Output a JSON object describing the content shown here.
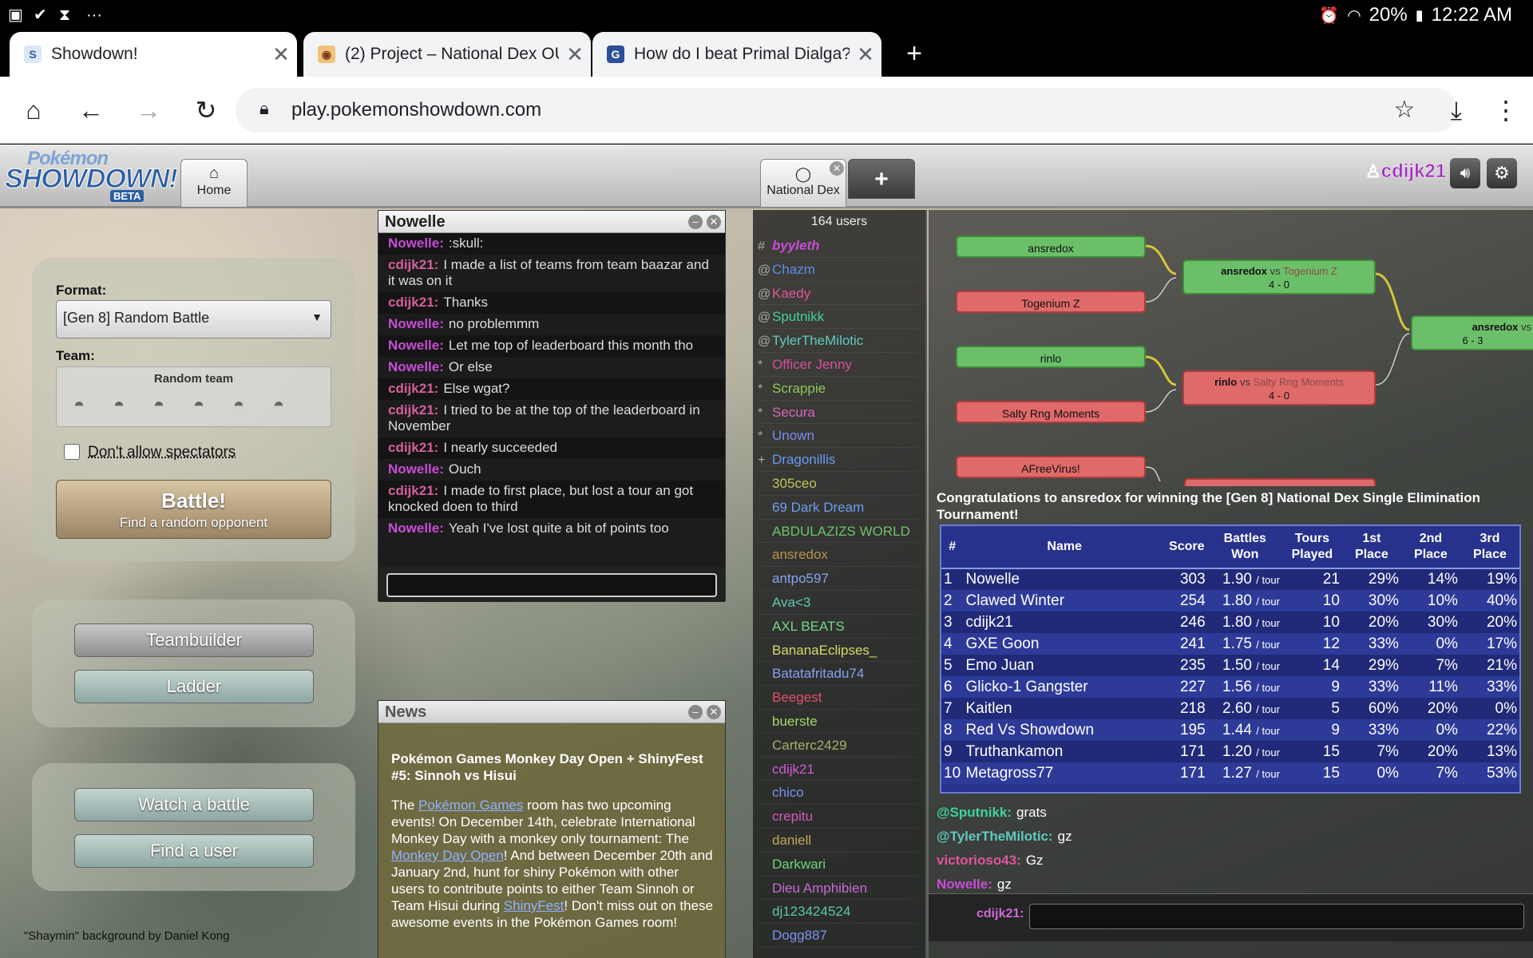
{
  "status": {
    "time": "12:22 AM",
    "battery": "20%",
    "icons": [
      "image-icon",
      "check-icon",
      "hourglass-icon",
      "more-icon"
    ]
  },
  "tabs": [
    {
      "title": "Showdown!",
      "favicon": "showdown-icon",
      "active": true
    },
    {
      "title": "(2) Project – National Dex OU",
      "favicon": "smogon-icon",
      "active": false
    },
    {
      "title": "How do I beat Primal Dialga?",
      "favicon": "gamefaqs-icon",
      "active": false
    }
  ],
  "browser": {
    "url": "play.pokemonshowdown.com"
  },
  "header": {
    "logo_line1": "Pokémon",
    "logo_line2": "SHOWDOWN!",
    "logo_badge": "BETA",
    "home_tab": "Home",
    "room_tab": "National Dex",
    "username": "cdijk21"
  },
  "menu": {
    "format_label": "Format:",
    "format_value": "[Gen 8] Random Battle",
    "team_label": "Team:",
    "team_value": "Random team",
    "spectators_label": "Don't allow spectators",
    "battle_label": "Battle!",
    "battle_sub": "Find a random opponent",
    "teambuilder": "Teambuilder",
    "ladder": "Ladder",
    "watch": "Watch a battle",
    "find_user": "Find a user",
    "credit": "\"Shaymin\" background by Daniel Kong"
  },
  "pm": {
    "title": "Nowelle",
    "messages": [
      {
        "user": "Nowelle:",
        "text": ":skull:",
        "color": "#c74dd6"
      },
      {
        "user": "cdijk21:",
        "text": "I made a list of teams from team baazar and it was on it",
        "color": "#d65f9a"
      },
      {
        "user": "cdijk21:",
        "text": "Thanks",
        "color": "#d65f9a"
      },
      {
        "user": "Nowelle:",
        "text": "no problemmm",
        "color": "#c74dd6"
      },
      {
        "user": "Nowelle:",
        "text": "Let me top of leaderboard this month tho",
        "color": "#c74dd6"
      },
      {
        "user": "Nowelle:",
        "text": "Or else",
        "color": "#c74dd6"
      },
      {
        "user": "cdijk21:",
        "text": "Else wgat?",
        "color": "#d65f9a"
      },
      {
        "user": "cdijk21:",
        "text": "I tried to be at the top of the leaderboard in November",
        "color": "#d65f9a"
      },
      {
        "user": "cdijk21:",
        "text": "I nearly succeeded",
        "color": "#d65f9a"
      },
      {
        "user": "Nowelle:",
        "text": "Ouch",
        "color": "#c74dd6"
      },
      {
        "user": "cdijk21:",
        "text": "I made to first place, but lost a tour an got knocked doen to third",
        "color": "#d65f9a"
      },
      {
        "user": "Nowelle:",
        "text": "Yeah I've lost quite a bit of points too",
        "color": "#c74dd6"
      }
    ]
  },
  "news": {
    "title": "News",
    "headline": "Pokémon Games Monkey Day Open + ShinyFest #5: Sinnoh vs Hisui",
    "t1": "The ",
    "link1": "Pokémon Games",
    "t2": " room has two upcoming events! On December 14th, celebrate International Monkey Day with a monkey only tournament: The ",
    "link2": "Monkey Day Open",
    "t3": "! And between December 20th and January 2nd, hunt for shiny Pokémon with other users to contribute points to either Team Sinnoh or Team Hisui during ",
    "link3": "ShinyFest",
    "t4": "! Don't miss out on these awesome events in the Pokémon Games room!"
  },
  "userlist": {
    "count": "164 users",
    "users": [
      {
        "rank": "#",
        "name": "byyleth",
        "color": "#c74dd6",
        "italic": true
      },
      {
        "rank": "@",
        "name": "Chazm",
        "color": "#5b8de8"
      },
      {
        "rank": "@",
        "name": "Kaedy",
        "color": "#e0559b"
      },
      {
        "rank": "@",
        "name": "Sputnikk",
        "color": "#3fd39a"
      },
      {
        "rank": "@",
        "name": "TylerTheMilotic",
        "color": "#5fc9c0"
      },
      {
        "rank": "*",
        "name": "Officer Jenny",
        "color": "#d44f9e"
      },
      {
        "rank": "*",
        "name": "Scrappie",
        "color": "#8ec95a"
      },
      {
        "rank": "*",
        "name": "Secura",
        "color": "#d667bd"
      },
      {
        "rank": "*",
        "name": "Unown",
        "color": "#7a8af0"
      },
      {
        "rank": "+",
        "name": "Dragonillis",
        "color": "#6a9af0"
      },
      {
        "rank": "",
        "name": "305ceo",
        "color": "#c2c25a"
      },
      {
        "rank": "",
        "name": "69 Dark Dream",
        "color": "#6d9ef0"
      },
      {
        "rank": "",
        "name": "ABDULAZIZS WORLD",
        "color": "#6ec26a"
      },
      {
        "rank": "",
        "name": "ansredox",
        "color": "#b8924e"
      },
      {
        "rank": "",
        "name": "antpo597",
        "color": "#8aa2f0"
      },
      {
        "rank": "",
        "name": "Ava<3",
        "color": "#5ec8b4"
      },
      {
        "rank": "",
        "name": "AXL BEATS",
        "color": "#78d48c"
      },
      {
        "rank": "",
        "name": "BananaEclipses_",
        "color": "#d8d86a"
      },
      {
        "rank": "",
        "name": "Batatafritadu74",
        "color": "#8a9ef0"
      },
      {
        "rank": "",
        "name": "Beegest",
        "color": "#e0506a"
      },
      {
        "rank": "",
        "name": "buerste",
        "color": "#a8d46a"
      },
      {
        "rank": "",
        "name": "Carterc2429",
        "color": "#a8b06a"
      },
      {
        "rank": "",
        "name": "cdijk21",
        "color": "#d15ad6"
      },
      {
        "rank": "",
        "name": "chico",
        "color": "#7a92f0"
      },
      {
        "rank": "",
        "name": "crepitu",
        "color": "#d25ab8"
      },
      {
        "rank": "",
        "name": "daniell",
        "color": "#c2a85a"
      },
      {
        "rank": "",
        "name": "Darkwari",
        "color": "#6ed47a"
      },
      {
        "rank": "",
        "name": "Dieu Amphibien",
        "color": "#c86ad2"
      },
      {
        "rank": "",
        "name": "dj123424524",
        "color": "#5ac8a0"
      },
      {
        "rank": "",
        "name": "Dogg887",
        "color": "#7a92f0"
      }
    ]
  },
  "bracket": {
    "nodes": [
      "ansredox",
      "Togenium Z",
      "rinlo",
      "Salty Rng Moments",
      "AFreeVirus!"
    ],
    "match1": {
      "p1": "ansredox",
      "vs": "vs",
      "p2": "Togenium Z",
      "score": "4 - 0"
    },
    "match2": {
      "p1": "rinlo",
      "vs": "vs",
      "p2": "Salty Rng Moments",
      "score": "4 - 0"
    },
    "match3": {
      "p1": "ansredox",
      "vs": "vs",
      "score": "6 - 3"
    }
  },
  "congrats": "Congratulations to ansredox for winning the [Gen 8] National Dex Single Elimination Tournament!",
  "leaderboard": {
    "headers": {
      "rank": "#",
      "name": "Name",
      "score": "Score",
      "battles": "Battles Won",
      "tours": "Tours Played",
      "first": "1st Place",
      "second": "2nd Place",
      "third": "3rd Place"
    },
    "unit": "/ tour",
    "rows": [
      {
        "rank": "1",
        "name": "Nowelle",
        "score": "303",
        "bw": "1.90",
        "tours": "21",
        "first": "29%",
        "second": "14%",
        "third": "19%"
      },
      {
        "rank": "2",
        "name": "Clawed Winter",
        "score": "254",
        "bw": "1.80",
        "tours": "10",
        "first": "30%",
        "second": "10%",
        "third": "40%"
      },
      {
        "rank": "3",
        "name": "cdijk21",
        "score": "246",
        "bw": "1.80",
        "tours": "10",
        "first": "20%",
        "second": "30%",
        "third": "20%"
      },
      {
        "rank": "4",
        "name": "GXE Goon",
        "score": "241",
        "bw": "1.75",
        "tours": "12",
        "first": "33%",
        "second": "0%",
        "third": "17%"
      },
      {
        "rank": "5",
        "name": "Emo Juan",
        "score": "235",
        "bw": "1.50",
        "tours": "14",
        "first": "29%",
        "second": "7%",
        "third": "21%"
      },
      {
        "rank": "6",
        "name": "Glicko-1 Gangster",
        "score": "227",
        "bw": "1.56",
        "tours": "9",
        "first": "33%",
        "second": "11%",
        "third": "33%"
      },
      {
        "rank": "7",
        "name": "Kaitlen",
        "score": "218",
        "bw": "2.60",
        "tours": "5",
        "first": "60%",
        "second": "20%",
        "third": "0%"
      },
      {
        "rank": "8",
        "name": "Red Vs Showdown",
        "score": "195",
        "bw": "1.44",
        "tours": "9",
        "first": "33%",
        "second": "0%",
        "third": "22%"
      },
      {
        "rank": "9",
        "name": "Truthankamon",
        "score": "171",
        "bw": "1.20",
        "tours": "15",
        "first": "7%",
        "second": "20%",
        "third": "13%"
      },
      {
        "rank": "10",
        "name": "Metagross77",
        "score": "171",
        "bw": "1.27",
        "tours": "15",
        "first": "0%",
        "second": "7%",
        "third": "53%"
      }
    ]
  },
  "roomchat": [
    {
      "user": "@Sputnikk:",
      "text": "grats",
      "color": "#3fd39a"
    },
    {
      "user": "@TylerTheMilotic:",
      "text": "gz",
      "color": "#5fc9c0"
    },
    {
      "user": "victorioso43:",
      "text": "Gz",
      "color": "#e0559b"
    },
    {
      "user": "Nowelle:",
      "text": "gz",
      "color": "#c74dd6"
    }
  ],
  "roominput_label": "cdijk21:"
}
